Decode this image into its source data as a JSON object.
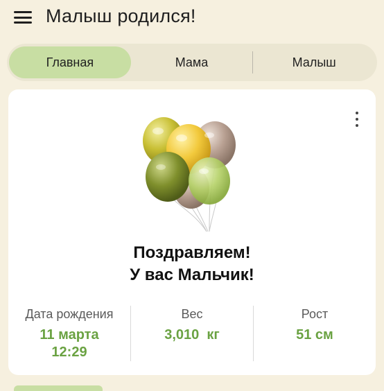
{
  "app": {
    "title": "Малыш родился!"
  },
  "tabs": [
    {
      "label": "Главная",
      "active": true
    },
    {
      "label": "Мама",
      "active": false
    },
    {
      "label": "Малыш",
      "active": false
    }
  ],
  "card": {
    "headline_line1": "Поздравляем!",
    "headline_line2": "У вас Мальчик!",
    "stats": [
      {
        "label": "Дата рождения",
        "value_line1": "11 марта",
        "value_line2": "12:29"
      },
      {
        "label": "Вес",
        "value_line1": "3,010  кг"
      },
      {
        "label": "Рост",
        "value_line1": "51 см"
      }
    ]
  },
  "icons": {
    "menu": "hamburger-icon",
    "more": "more-vert-icon",
    "illustration": "balloons-illustration"
  },
  "colors": {
    "background": "#f6f0df",
    "accent": "#6aa242",
    "active_tab": "#c8dea3",
    "tab_bar": "#ebe6d2"
  }
}
